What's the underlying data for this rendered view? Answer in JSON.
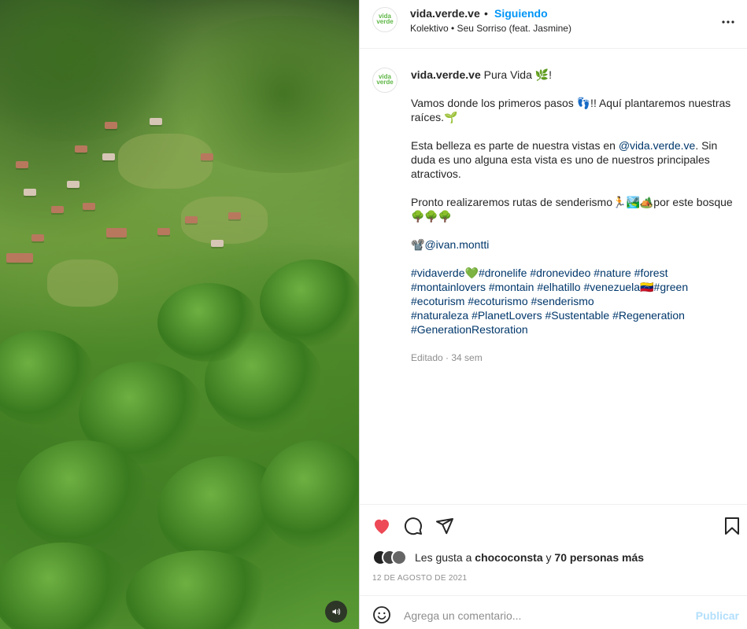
{
  "post": {
    "username": "vida.verde.ve",
    "separator": "•",
    "follow_label": "Siguiendo",
    "audio": "Kolektivo • Seu Sorriso (feat. Jasmine)",
    "avatar_text": [
      "vida",
      "verde"
    ],
    "more_icon": "more-horizontal-icon"
  },
  "caption": {
    "username": "vida.verde.ve",
    "line1": "Pura Vida 🌿!",
    "para2": "Vamos donde los primeros pasos 👣!! Aquí plantaremos nuestras raíces.🌱",
    "para3_before": "Esta belleza es parte de nuestra vistas en ",
    "para3_mention": "@vida.verde.ve",
    "para3_after": ". Sin duda es uno alguna esta vista es uno de nuestros principales atractivos.",
    "para4": "Pronto realizaremos rutas de senderismo🏃🏞️🏕️por este bosque 🌳🌳🌳",
    "credit_icon": "📽️",
    "credit_mention": "@ivan.montti",
    "hashtags": [
      "#vidaverde",
      "💚",
      "#dronelife",
      " ",
      "#dronevideo",
      " ",
      "#nature",
      " ",
      "#forest",
      "\n",
      "#montainlovers",
      " ",
      "#montain",
      " ",
      "#elhatillo",
      " ",
      "#venezuela",
      "🇻🇪",
      "#green",
      "\n",
      "#ecoturism",
      " ",
      "#ecoturismo",
      " ",
      "#senderismo",
      "\n",
      "#naturaleza",
      " ",
      "#PlanetLovers",
      " ",
      "#Sustentable",
      " ",
      "#Regeneration",
      "\n",
      "#GenerationRestoration"
    ],
    "meta": "Editado · 34 sem"
  },
  "actions": {
    "like_icon": "heart-filled-icon",
    "comment_icon": "comment-icon",
    "share_icon": "paper-plane-icon",
    "save_icon": "bookmark-icon",
    "liked_color": "#ed4956",
    "likes_prefix": "Les gusta a ",
    "likes_user": "chococonsta",
    "likes_mid": " y ",
    "likes_others": "70 personas más",
    "date": "12 DE AGOSTO DE 2021"
  },
  "comment": {
    "placeholder": "Agrega un comentario...",
    "publish_label": "Publicar",
    "emoji_icon": "smiley-icon"
  },
  "media": {
    "audio_toggle_icon": "speaker-icon"
  }
}
